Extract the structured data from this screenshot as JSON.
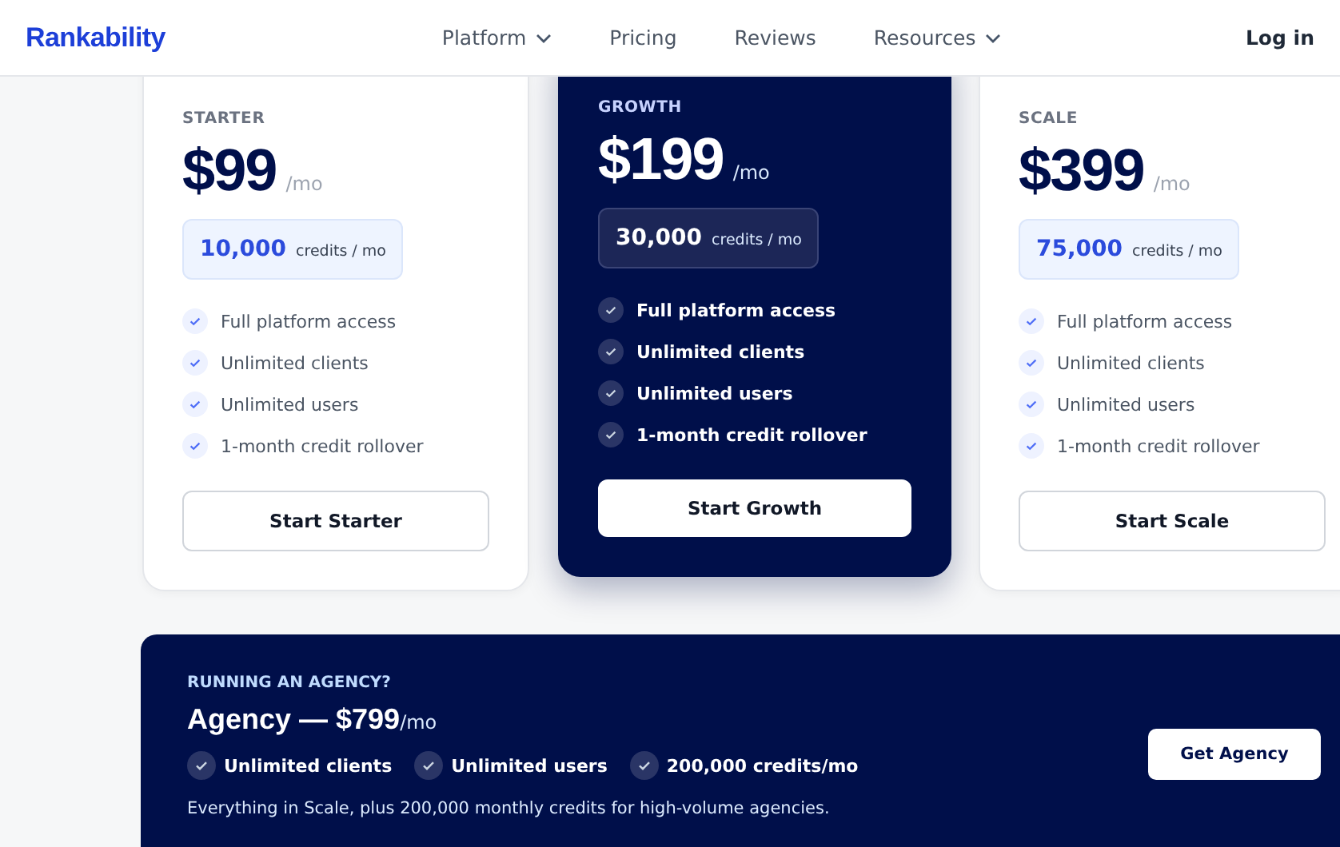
{
  "nav": {
    "logo": "Rankability",
    "links": [
      {
        "label": "Platform",
        "dropdown": true
      },
      {
        "label": "Pricing",
        "dropdown": false
      },
      {
        "label": "Reviews",
        "dropdown": false
      },
      {
        "label": "Resources",
        "dropdown": true
      }
    ],
    "login": "Log in"
  },
  "plans": [
    {
      "name": "STARTER",
      "featured": false,
      "price": "$99",
      "period": "/mo",
      "credits": "10,000",
      "credits_unit": "credits / mo",
      "features": [
        "Full platform access",
        "Unlimited clients",
        "Unlimited users",
        "1-month credit rollover"
      ],
      "button": "Start Starter"
    },
    {
      "name": "GROWTH",
      "featured": true,
      "price": "$199",
      "period": "/mo",
      "credits": "30,000",
      "credits_unit": "credits / mo",
      "features": [
        "Full platform access",
        "Unlimited clients",
        "Unlimited users",
        "1-month credit rollover"
      ],
      "button": "Start Growth"
    },
    {
      "name": "SCALE",
      "featured": false,
      "price": "$399",
      "period": "/mo",
      "credits": "75,000",
      "credits_unit": "credits / mo",
      "features": [
        "Full platform access",
        "Unlimited clients",
        "Unlimited users",
        "1-month credit rollover"
      ],
      "button": "Start Scale"
    }
  ],
  "agency": {
    "eyebrow": "RUNNING AN AGENCY?",
    "title": "Agency — $799",
    "period": "/mo",
    "features": [
      "Unlimited clients",
      "Unlimited users",
      "200,000 credits/mo"
    ],
    "description": "Everything in Scale, plus 200,000 monthly credits for high-volume agencies.",
    "button": "Get Agency"
  }
}
